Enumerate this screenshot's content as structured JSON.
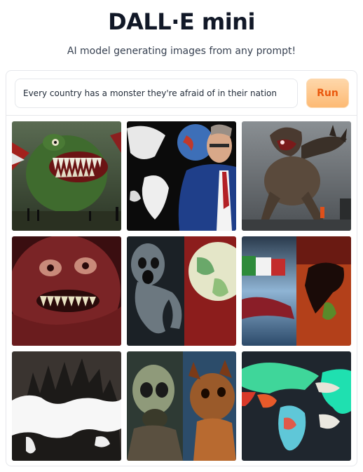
{
  "header": {
    "title": "DALL·E mini",
    "subtitle": "AI model generating images from any prompt!"
  },
  "prompt": {
    "value": "Every country has a monster they're afraid of in their nation"
  },
  "run_button": {
    "label": "Run"
  },
  "colors": {
    "accent": "#ea580c",
    "button_bg": "#fdba74",
    "border": "#e5e7eb"
  },
  "results": {
    "images": [
      {
        "subject": "green-sea-monster"
      },
      {
        "subject": "world-map-and-politician"
      },
      {
        "subject": "brown-winged-creature"
      },
      {
        "subject": "red-furry-monster"
      },
      {
        "subject": "ghost-and-globe"
      },
      {
        "subject": "flags-and-world-map"
      },
      {
        "subject": "world-map-silhouette"
      },
      {
        "subject": "alien-and-lion-beast"
      },
      {
        "subject": "colorful-world-map"
      }
    ]
  }
}
